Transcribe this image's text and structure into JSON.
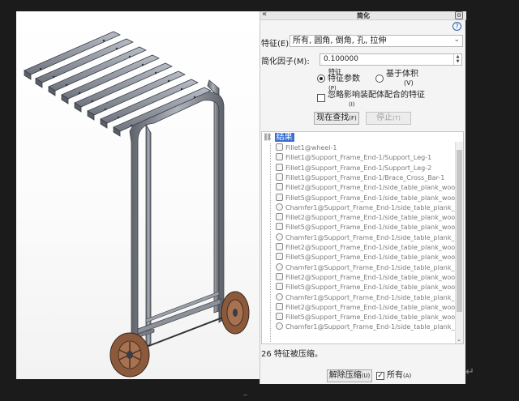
{
  "pane": {
    "title": "简化",
    "collapse_glyph": "«",
    "settings_glyph": "⚙",
    "help_glyph": "?"
  },
  "feature": {
    "label": "特征(E):",
    "value": "所有, 圆角, 倒角, 孔, 拉伸"
  },
  "factor": {
    "label": "简化因子(M):",
    "value": "0.100000"
  },
  "options": {
    "radio_feature_params": "特征参数",
    "radio_feature_params_top": "特征",
    "radio_feature_params_key": "(P)",
    "radio_body_volume": "基于体积",
    "radio_body_volume_key": "(V)",
    "selected": "feature_params",
    "ignore_mates_label": "忽略影响装配体配合的特征",
    "ignore_mates_key": "(I)",
    "ignore_mates_checked": false
  },
  "buttons": {
    "find_now": "现在查找",
    "find_now_key": "(F)",
    "stop": "停止",
    "stop_key": "(T)",
    "unsuppress": "解除压缩",
    "unsuppress_key": "(U)",
    "all_label": "所有",
    "all_key": "(A)",
    "all_checked": true
  },
  "results": {
    "header": "结果",
    "items": [
      {
        "type": "fillet",
        "label": "Fillet1@wheel-1"
      },
      {
        "type": "fillet",
        "label": "Fillet1@Support_Frame_End-1/Support_Leg-1"
      },
      {
        "type": "fillet",
        "label": "Fillet1@Support_Frame_End-1/Support_Leg-2"
      },
      {
        "type": "fillet",
        "label": "Fillet1@Support_Frame_End-1/Brace_Cross_Bar-1"
      },
      {
        "type": "fillet",
        "label": "Fillet2@Support_Frame_End-1/side_table_plank_wood-1"
      },
      {
        "type": "fillet",
        "label": "Fillet5@Support_Frame_End-1/side_table_plank_wood-1"
      },
      {
        "type": "chamfer",
        "label": "Chamfer1@Support_Frame_End-1/side_table_plank_woo"
      },
      {
        "type": "fillet",
        "label": "Fillet2@Support_Frame_End-1/side_table_plank_wood-1"
      },
      {
        "type": "fillet",
        "label": "Fillet5@Support_Frame_End-1/side_table_plank_wood-1"
      },
      {
        "type": "chamfer",
        "label": "Chamfer1@Support_Frame_End-1/side_table_plank_woo"
      },
      {
        "type": "fillet",
        "label": "Fillet2@Support_Frame_End-1/side_table_plank_wood-1"
      },
      {
        "type": "fillet",
        "label": "Fillet5@Support_Frame_End-1/side_table_plank_wood-1"
      },
      {
        "type": "chamfer",
        "label": "Chamfer1@Support_Frame_End-1/side_table_plank_woo"
      },
      {
        "type": "fillet",
        "label": "Fillet2@Support_Frame_End-1/side_table_plank_wood-1"
      },
      {
        "type": "fillet",
        "label": "Fillet5@Support_Frame_End-1/side_table_plank_wood-1"
      },
      {
        "type": "chamfer",
        "label": "Chamfer1@Support_Frame_End-1/side_table_plank_woo"
      },
      {
        "type": "fillet",
        "label": "Fillet2@Support_Frame_End-1/side_table_plank_wood-1"
      },
      {
        "type": "fillet",
        "label": "Fillet5@Support_Frame_End-1/side_table_plank_wood-1"
      },
      {
        "type": "chamfer",
        "label": "Chamfer1@Support_Frame_End-1/side_table_plank_woo"
      }
    ]
  },
  "status": "26 特征被压缩。",
  "colors": {
    "accent": "#3b6fd0",
    "wheel": "#8b5a3c",
    "frame": "#8a8e96",
    "plank": "#9aa0ab"
  }
}
